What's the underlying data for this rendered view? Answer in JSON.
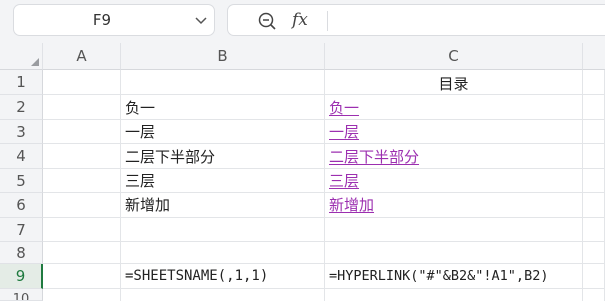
{
  "name_box": {
    "value": "F9"
  },
  "formula_bar": {
    "fx_label": "fx",
    "value": ""
  },
  "columns": [
    "A",
    "B",
    "C"
  ],
  "rows": [
    "1",
    "2",
    "3",
    "4",
    "5",
    "6",
    "7",
    "8",
    "9",
    "10"
  ],
  "active_row": "9",
  "cells": {
    "C1": "目录",
    "B2": "负一",
    "C2": "负一",
    "B3": "一层",
    "C3": "一层",
    "B4": "二层下半部分",
    "C4": "二层下半部分",
    "B5": "三层",
    "C5": "三层",
    "B6": "新增加",
    "C6": "新增加",
    "B9": "=SHEETSNAME(,1,1)",
    "C9": "=HYPERLINK(\"#\"&B2&\"!A1\",B2)"
  },
  "colors": {
    "accent": "#1f7a3f",
    "hyperlink": "#9c2fb0"
  }
}
